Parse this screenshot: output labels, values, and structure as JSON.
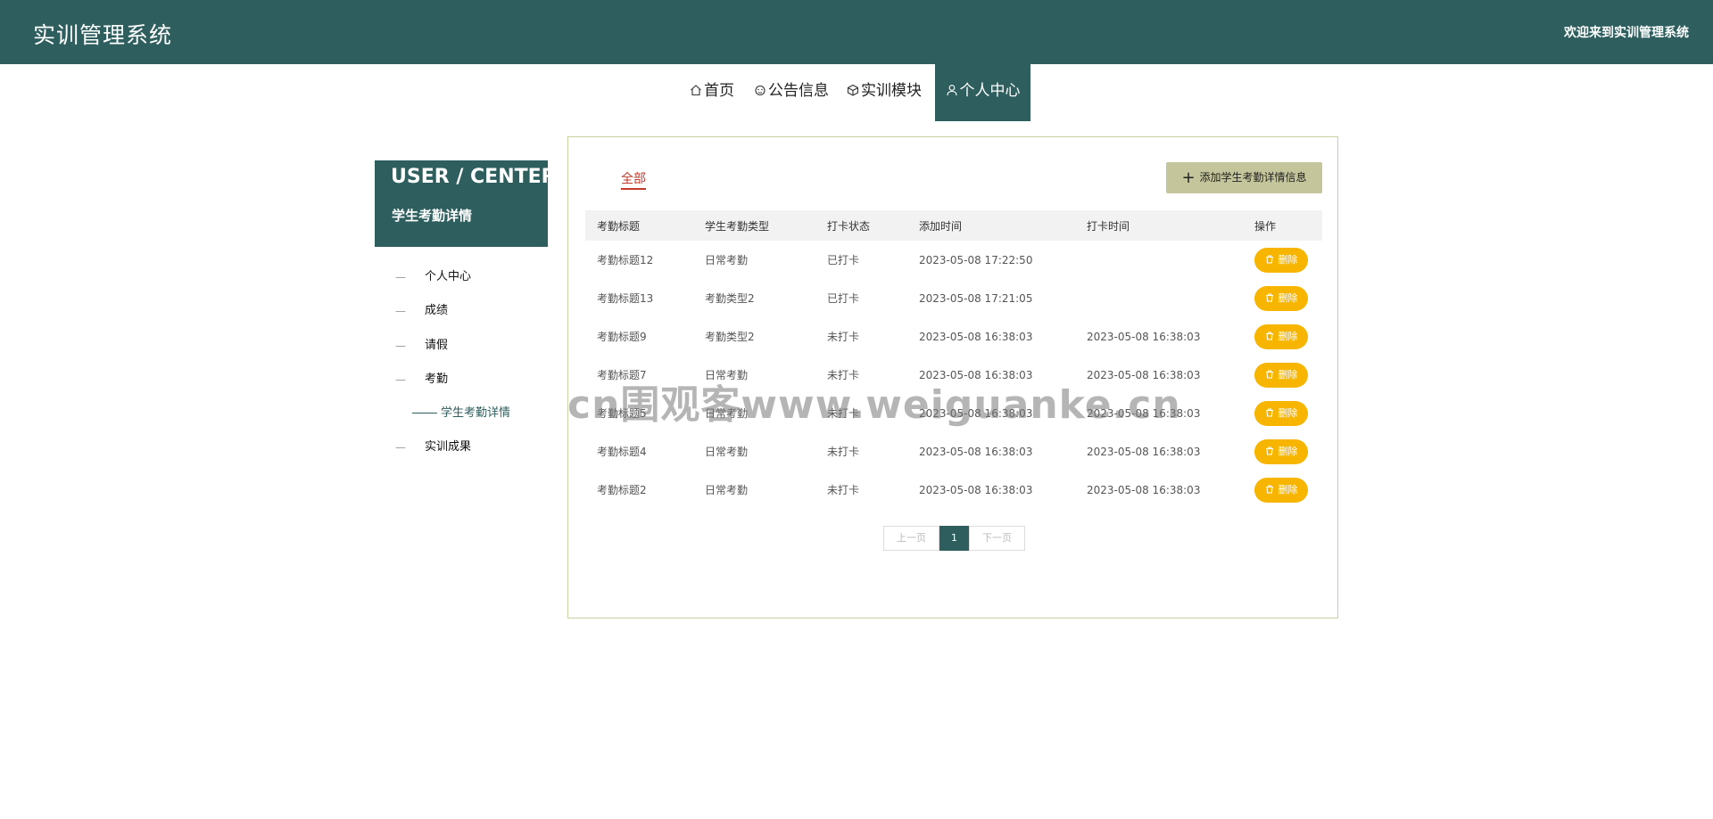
{
  "header": {
    "app_title": "实训管理系统",
    "welcome": "欢迎来到实训管理系统"
  },
  "nav": {
    "items": [
      {
        "label": "首页",
        "icon": "home-icon"
      },
      {
        "label": "公告信息",
        "icon": "bell-icon"
      },
      {
        "label": "实训模块",
        "icon": "cube-icon"
      },
      {
        "label": "个人中心",
        "icon": "user-icon",
        "active": true
      }
    ]
  },
  "sidebar": {
    "heading_en": "USER / CENTER",
    "heading_cn": "学生考勤详情",
    "items": [
      {
        "dash": "—",
        "label": "个人中心"
      },
      {
        "dash": "—",
        "label": "成绩"
      },
      {
        "dash": "—",
        "label": "请假"
      },
      {
        "dash": "—",
        "label": "考勤"
      },
      {
        "label": "学生考勤详情",
        "sub": true
      },
      {
        "dash": "—",
        "label": "实训成果"
      }
    ]
  },
  "main": {
    "tab_all": "全部",
    "add_button": "添加学生考勤详情信息",
    "table": {
      "headers": [
        "考勤标题",
        "学生考勤类型",
        "打卡状态",
        "添加时间",
        "打卡时间",
        "操作"
      ],
      "rows": [
        [
          "考勤标题12",
          "日常考勤",
          "已打卡",
          "2023-05-08 17:22:50",
          ""
        ],
        [
          "考勤标题13",
          "考勤类型2",
          "已打卡",
          "2023-05-08 17:21:05",
          ""
        ],
        [
          "考勤标题9",
          "考勤类型2",
          "未打卡",
          "2023-05-08 16:38:03",
          "2023-05-08 16:38:03"
        ],
        [
          "考勤标题7",
          "日常考勤",
          "未打卡",
          "2023-05-08 16:38:03",
          "2023-05-08 16:38:03"
        ],
        [
          "考勤标题5",
          "日常考勤",
          "未打卡",
          "2023-05-08 16:38:03",
          "2023-05-08 16:38:03"
        ],
        [
          "考勤标题4",
          "日常考勤",
          "未打卡",
          "2023-05-08 16:38:03",
          "2023-05-08 16:38:03"
        ],
        [
          "考勤标题2",
          "日常考勤",
          "未打卡",
          "2023-05-08 16:38:03",
          "2023-05-08 16:38:03"
        ]
      ],
      "delete_label": "删除"
    },
    "pager": {
      "prev": "上一页",
      "current": "1",
      "next": "下一页"
    }
  },
  "watermark": "cn围观客www.weiguanke.cn",
  "colors": {
    "primary": "#2e5f5e",
    "accent_red": "#c0392b",
    "add_button": "#c4c59a",
    "delete_button": "#f7b500"
  }
}
